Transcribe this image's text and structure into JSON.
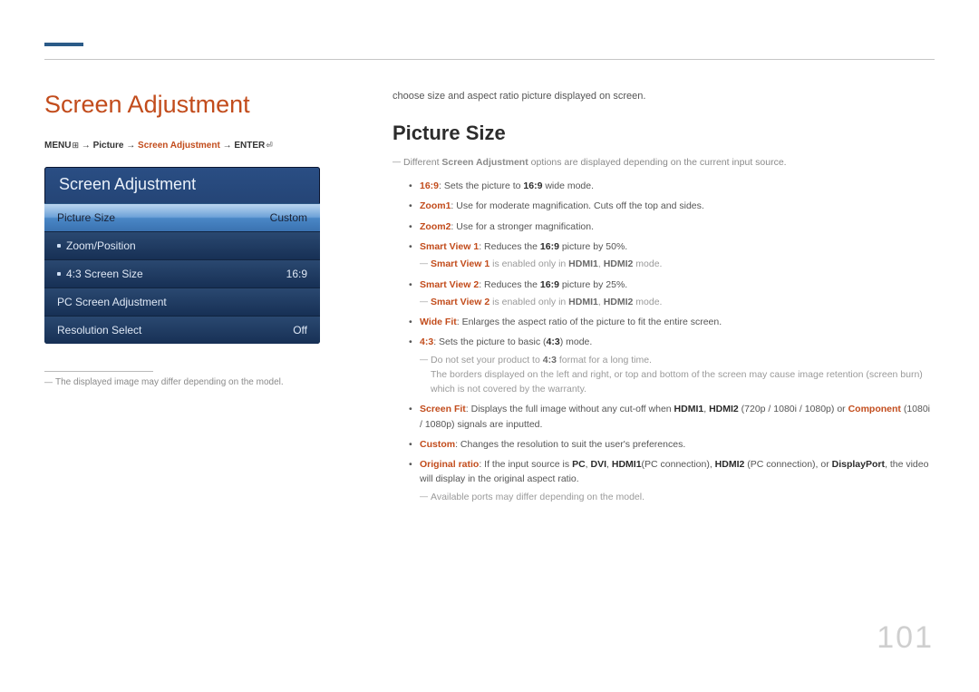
{
  "title": "Screen Adjustment",
  "breadcrumb": {
    "menu": "MENU",
    "arrow": "→",
    "p1": "Picture",
    "p2": "Screen Adjustment",
    "enter": "ENTER",
    "menu_icon": "⊞",
    "enter_icon": "⏎"
  },
  "panel": {
    "header": "Screen Adjustment",
    "items": [
      {
        "label": "Picture Size",
        "value": "Custom",
        "selected": true,
        "dot": false
      },
      {
        "label": "Zoom/Position",
        "value": "",
        "selected": false,
        "dot": true
      },
      {
        "label": "4:3 Screen Size",
        "value": "16:9",
        "selected": false,
        "dot": true
      },
      {
        "label": "PC Screen Adjustment",
        "value": "",
        "selected": false,
        "dot": false
      },
      {
        "label": "Resolution Select",
        "value": "Off",
        "selected": false,
        "dot": false
      }
    ]
  },
  "footnote": "The displayed image may differ depending on the model.",
  "intro": "choose size and aspect ratio picture displayed on screen.",
  "subhead": "Picture Size",
  "note1_pre": "Different ",
  "note1_bold": "Screen Adjustment",
  "note1_post": " options are displayed depending on the current input source.",
  "bullets": {
    "b1_k": "16:9",
    "b1_t1": ": Sets the picture to ",
    "b1_t2": "16:9",
    "b1_t3": " wide mode.",
    "b2_k": "Zoom1",
    "b2_t": ": Use for moderate magnification. Cuts off the top and sides.",
    "b3_k": "Zoom2",
    "b3_t": ": Use for a stronger magnification.",
    "b4_k": "Smart View 1",
    "b4_t1": ": Reduces the ",
    "b4_t2": "16:9",
    "b4_t3": " picture by 50%.",
    "b4_n_k": "Smart View 1",
    "b4_n_t1": " is enabled only in ",
    "b4_n_h1": "HDMI1",
    "b4_n_c": ", ",
    "b4_n_h2": "HDMI2",
    "b4_n_t2": " mode.",
    "b5_k": "Smart View 2",
    "b5_t1": ": Reduces the ",
    "b5_t2": "16:9",
    "b5_t3": " picture by 25%.",
    "b5_n_k": "Smart View 2",
    "b5_n_t1": " is enabled only in ",
    "b5_n_h1": "HDMI1",
    "b5_n_c": ", ",
    "b5_n_h2": "HDMI2",
    "b5_n_t2": " mode.",
    "b6_k": "Wide Fit",
    "b6_t": ": Enlarges the aspect ratio of the picture to fit the entire screen.",
    "b7_k": "4:3",
    "b7_t1": ": Sets the picture to basic (",
    "b7_t2": "4:3",
    "b7_t3": ") mode.",
    "b7_n1_t1": "Do not set your product to ",
    "b7_n1_t2": "4:3",
    "b7_n1_t3": " format for a long time.",
    "b7_n2": "The borders displayed on the left and right, or top and bottom of the screen may cause image retention (screen burn) which is not covered by the warranty.",
    "b8_k": "Screen Fit",
    "b8_t1": ": Displays the full image without any cut-off when ",
    "b8_h1": "HDMI1",
    "b8_c1": ", ",
    "b8_h2": "HDMI2",
    "b8_t2": " (720p / 1080i / 1080p) or ",
    "b8_comp": "Component",
    "b8_t3": " (1080i / 1080p) signals are inputted.",
    "b9_k": "Custom",
    "b9_t": ": Changes the resolution to suit the user's preferences.",
    "b10_k": "Original ratio",
    "b10_t1": ": If the input source is ",
    "b10_pc": "PC",
    "b10_c1": ", ",
    "b10_dvi": "DVI",
    "b10_c2": ", ",
    "b10_h1": "HDMI1",
    "b10_t2": "(PC connection), ",
    "b10_h2": "HDMI2",
    "b10_t3": " (PC connection), or ",
    "b10_dp": "DisplayPort",
    "b10_t4": ", the video will display in the original aspect ratio.",
    "b10_n": "Available ports may differ depending on the model."
  },
  "page_number": "101"
}
